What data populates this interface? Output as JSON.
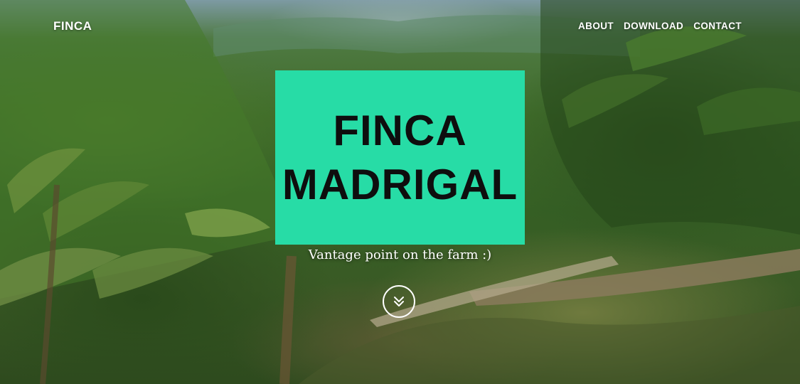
{
  "navbar": {
    "brand": "FINCA",
    "links": [
      {
        "label": "ABOUT"
      },
      {
        "label": "DOWNLOAD"
      },
      {
        "label": "CONTACT"
      }
    ]
  },
  "hero": {
    "title_line1": "FINCA",
    "title_line2": "MADRIGAL",
    "subtitle": "Vantage point on the farm :)",
    "scroll_icon": "double-chevron-down-icon",
    "title_bg_color": "#27dca6"
  }
}
